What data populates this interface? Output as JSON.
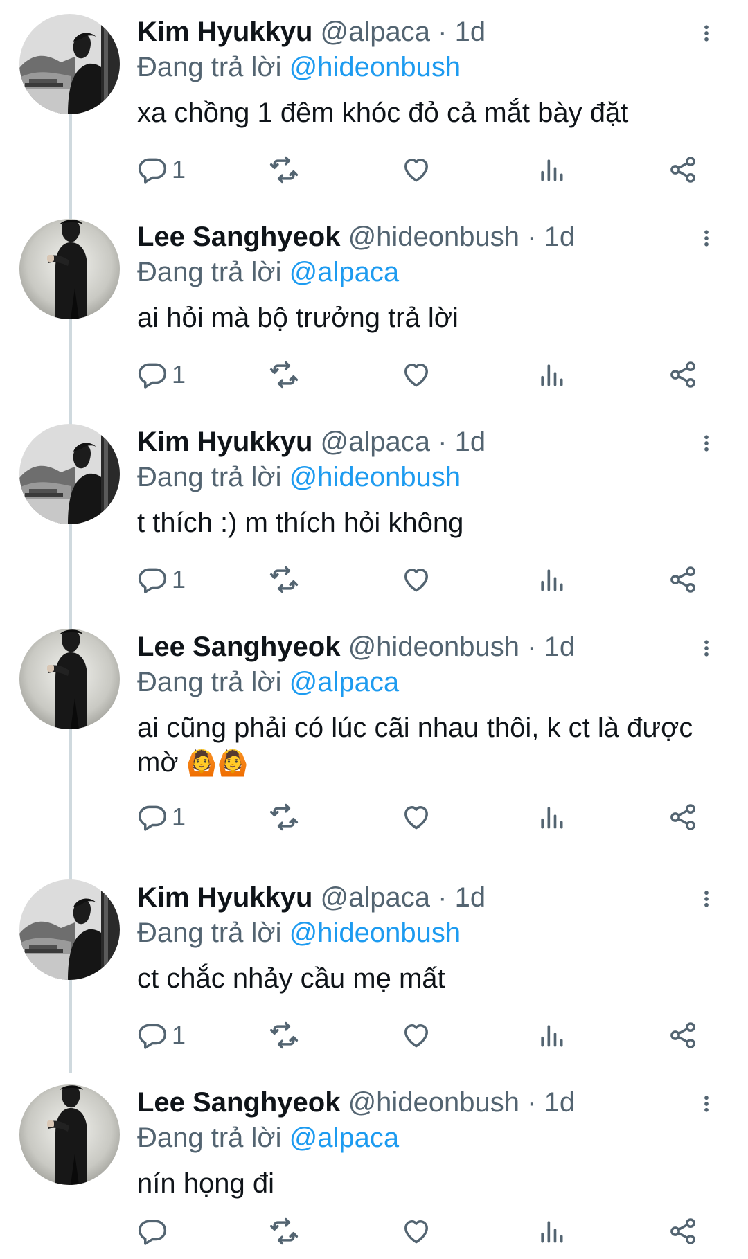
{
  "replying_label": "Đang trả lời",
  "tweets": [
    {
      "name": "Kim Hyukkyu",
      "handle": "@alpaca",
      "separator": "·",
      "time": "1d",
      "reply_to": "@hideonbush",
      "text": "xa chồng 1 đêm khóc đỏ cả mắt bày đặt",
      "reply_count": "1",
      "avatar": "kim-hyukkyu"
    },
    {
      "name": "Lee Sanghyeok",
      "handle": "@hideonbush",
      "separator": "·",
      "time": "1d",
      "reply_to": "@alpaca",
      "text": "ai hỏi mà bộ trưởng trả lời",
      "reply_count": "1",
      "avatar": "lee-sanghyeok"
    },
    {
      "name": "Kim Hyukkyu",
      "handle": "@alpaca",
      "separator": "·",
      "time": "1d",
      "reply_to": "@hideonbush",
      "text": "t thích :) m thích hỏi không",
      "reply_count": "1",
      "avatar": "kim-hyukkyu"
    },
    {
      "name": "Lee Sanghyeok",
      "handle": "@hideonbush",
      "separator": "·",
      "time": "1d",
      "reply_to": "@alpaca",
      "text": "ai cũng phải có lúc cãi nhau thôi, k ct là được mờ",
      "emoji": "🙆🙆",
      "reply_count": "1",
      "avatar": "lee-sanghyeok"
    },
    {
      "name": "Kim Hyukkyu",
      "handle": "@alpaca",
      "separator": "·",
      "time": "1d",
      "reply_to": "@hideonbush",
      "text": "ct chắc nhảy cầu mẹ mất",
      "reply_count": "1",
      "avatar": "kim-hyukkyu"
    },
    {
      "name": "Lee Sanghyeok",
      "handle": "@hideonbush",
      "separator": "·",
      "time": "1d",
      "reply_to": "@alpaca",
      "text": "nín họng đi",
      "reply_count": "",
      "avatar": "lee-sanghyeok"
    }
  ],
  "icons": {
    "more": "more-vertical-icon",
    "reply": "reply-bubble-icon",
    "retweet": "retweet-icon",
    "like": "heart-icon",
    "views": "views-chart-icon",
    "share": "share-icon"
  },
  "colors": {
    "text": "#0f1419",
    "secondary": "#536471",
    "mention": "#1d9bf0",
    "thread_line": "#cfd9de"
  }
}
